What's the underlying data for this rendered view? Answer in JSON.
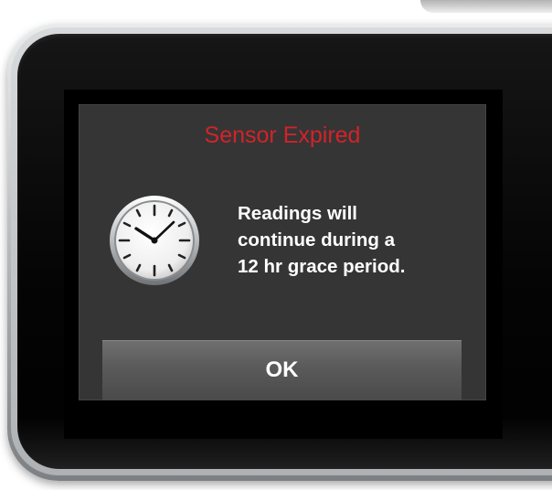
{
  "dialog": {
    "title": "Sensor Expired",
    "message_lines": [
      "Readings will",
      "continue during a",
      "12 hr grace period."
    ],
    "icon": "clock-icon",
    "ok_label": "OK"
  },
  "colors": {
    "title": "#d2232a",
    "dialog_background": "#353535",
    "button": "#5a5a5a",
    "text": "#ffffff"
  }
}
